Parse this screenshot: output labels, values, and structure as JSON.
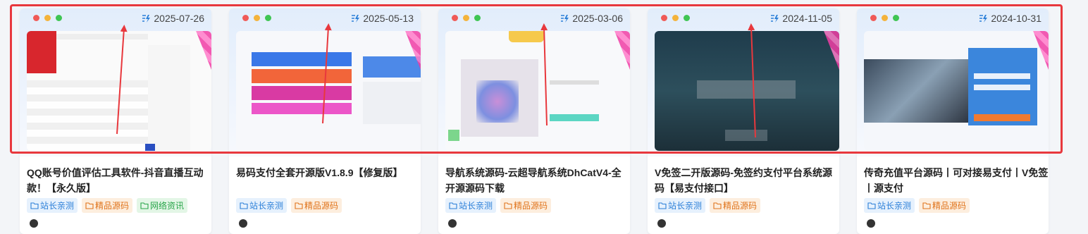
{
  "cards": [
    {
      "date": "2025-07-26",
      "title": "QQ账号价值评估工具软件-抖音直播互动款！【永久版】",
      "tags": [
        {
          "label": "站长亲测",
          "color": "blue"
        },
        {
          "label": "精品源码",
          "color": "orange"
        },
        {
          "label": "网络资讯",
          "color": "green"
        }
      ]
    },
    {
      "date": "2025-05-13",
      "title": "易码支付全套开源版V1.8.9【修复版】",
      "tags": [
        {
          "label": "站长亲测",
          "color": "blue"
        },
        {
          "label": "精品源码",
          "color": "orange"
        }
      ]
    },
    {
      "date": "2025-03-06",
      "title": "导航系统源码-云超导航系统DhCatV4-全开源源码下载",
      "tags": [
        {
          "label": "站长亲测",
          "color": "blue"
        },
        {
          "label": "精品源码",
          "color": "orange"
        }
      ]
    },
    {
      "date": "2024-11-05",
      "title": "V免签二开版源码-免签约支付平台系统源码【易支付接口】",
      "tags": [
        {
          "label": "站长亲测",
          "color": "blue"
        },
        {
          "label": "精品源码",
          "color": "orange"
        }
      ]
    },
    {
      "date": "2024-10-31",
      "title": "传奇充值平台源码丨可对接易支付丨V免签丨源支付",
      "tags": [
        {
          "label": "站长亲测",
          "color": "blue"
        },
        {
          "label": "精品源码",
          "color": "orange"
        }
      ]
    }
  ],
  "colors": {
    "highlight_frame": "#e8383d",
    "tag_blue": "#2b7fd8",
    "tag_orange": "#e0741c",
    "tag_green": "#29a54a"
  },
  "icons": {
    "date": "lightning-edit-icon",
    "tag": "folder-icon",
    "window_controls": "traffic-light-dots"
  }
}
